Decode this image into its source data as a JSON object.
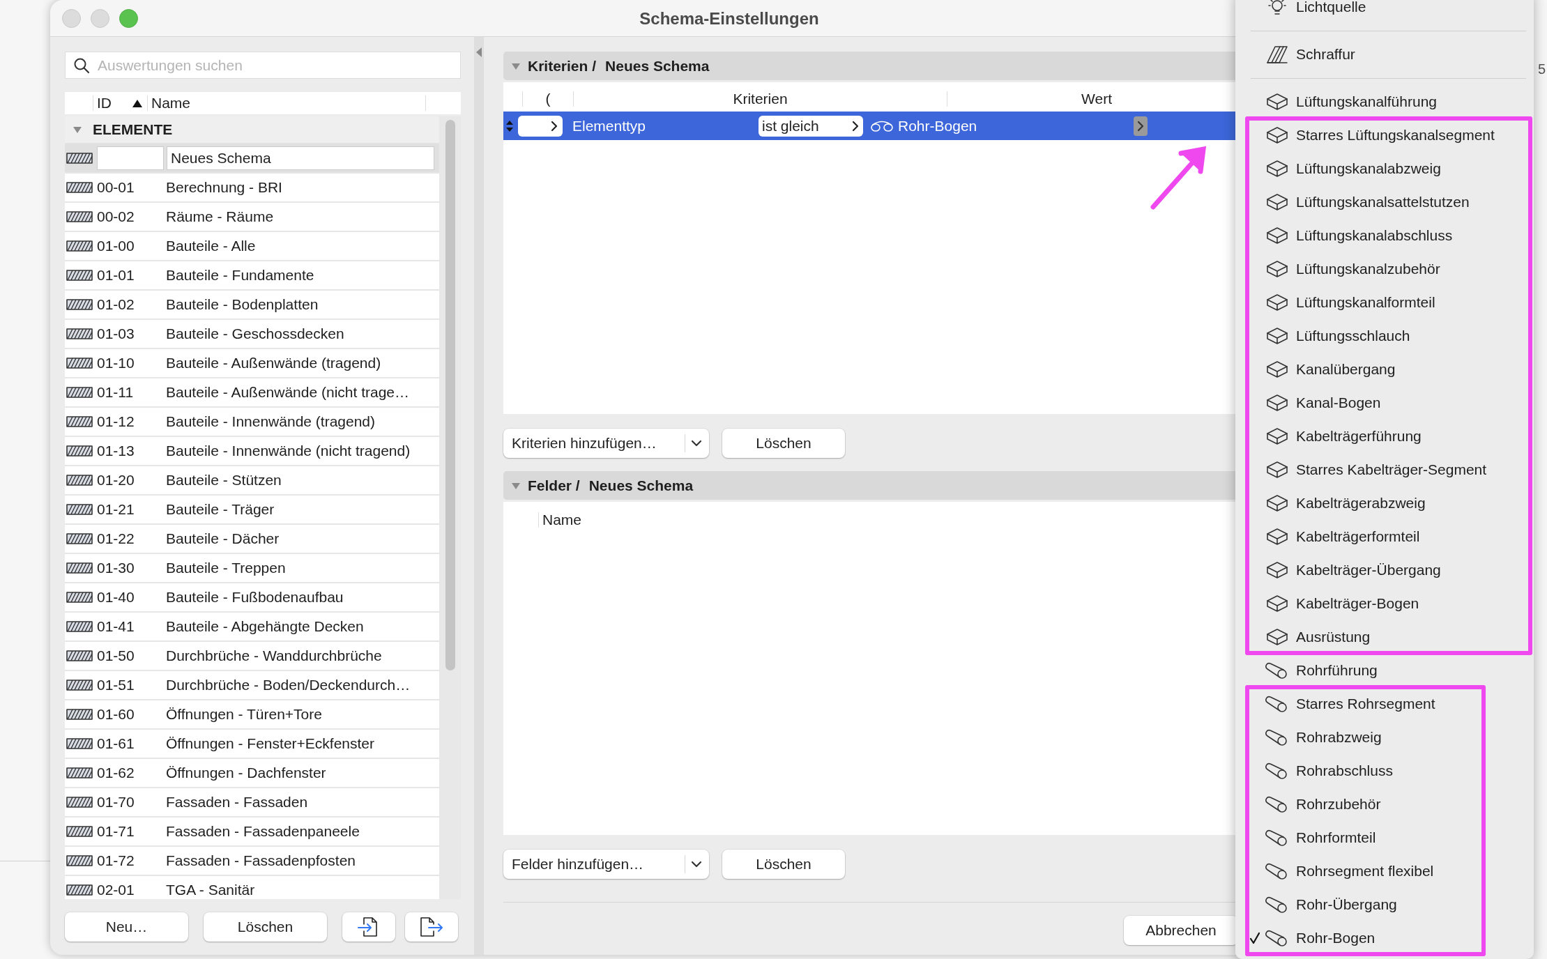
{
  "window": {
    "title": "Schema-Einstellungen"
  },
  "sidebar": {
    "search": {
      "placeholder": "Auswertungen suchen"
    },
    "columns": [
      {
        "label": "ID",
        "sorted": true
      },
      {
        "label": "Name",
        "sorted": false
      }
    ],
    "group": {
      "label": "ELEMENTE",
      "expanded": true
    },
    "rows": [
      {
        "name": "Neues Schema",
        "editing": true
      },
      {
        "id": "00-01",
        "name": "Berechnung - BRI",
        "editing": false
      },
      {
        "id": "00-02",
        "name": "Räume - Räume",
        "editing": false
      },
      {
        "id": "01-00",
        "name": "Bauteile - Alle",
        "editing": false
      },
      {
        "id": "01-01",
        "name": "Bauteile - Fundamente",
        "editing": false
      },
      {
        "id": "01-02",
        "name": "Bauteile - Bodenplatten",
        "editing": false
      },
      {
        "id": "01-03",
        "name": "Bauteile - Geschossdecken",
        "editing": false
      },
      {
        "id": "01-10",
        "name": "Bauteile - Außenwände (tragend)",
        "editing": false
      },
      {
        "id": "01-11",
        "name": "Bauteile - Außenwände (nicht trage…",
        "editing": false
      },
      {
        "id": "01-12",
        "name": "Bauteile - Innenwände (tragend)",
        "editing": false
      },
      {
        "id": "01-13",
        "name": "Bauteile - Innenwände (nicht tragend)",
        "editing": false
      },
      {
        "id": "01-20",
        "name": "Bauteile - Stützen",
        "editing": false
      },
      {
        "id": "01-21",
        "name": "Bauteile - Träger",
        "editing": false
      },
      {
        "id": "01-22",
        "name": "Bauteile - Dächer",
        "editing": false
      },
      {
        "id": "01-30",
        "name": "Bauteile - Treppen",
        "editing": false
      },
      {
        "id": "01-40",
        "name": "Bauteile - Fußbodenaufbau",
        "editing": false
      },
      {
        "id": "01-41",
        "name": "Bauteile - Abgehängte Decken",
        "editing": false
      },
      {
        "id": "01-50",
        "name": "Durchbrüche - Wanddurchbrüche",
        "editing": false
      },
      {
        "id": "01-51",
        "name": "Durchbrüche - Boden/Deckendurch…",
        "editing": false
      },
      {
        "id": "01-60",
        "name": "Öffnungen - Türen+Tore",
        "editing": false
      },
      {
        "id": "01-61",
        "name": "Öffnungen - Fenster+Eckfenster",
        "editing": false
      },
      {
        "id": "01-62",
        "name": "Öffnungen - Dachfenster",
        "editing": false
      },
      {
        "id": "01-70",
        "name": "Fassaden - Fassaden",
        "editing": false
      },
      {
        "id": "01-71",
        "name": "Fassaden - Fassadenpaneele",
        "editing": false
      },
      {
        "id": "01-72",
        "name": "Fassaden - Fassadenpfosten",
        "editing": false
      },
      {
        "id": "02-01",
        "name": "TGA - Sanitär",
        "editing": false
      }
    ],
    "buttons": [
      {
        "kind": "text",
        "label": "Neu…"
      },
      {
        "kind": "text",
        "label": "Löschen"
      },
      {
        "kind": "import"
      },
      {
        "kind": "export"
      }
    ]
  },
  "criteria": {
    "title": "Kriterien /",
    "schema": "Neues Schema",
    "expanded": true,
    "columns": [
      "(",
      "Kriterien",
      "Wert"
    ],
    "rows": [
      {
        "selected": true,
        "field": "Elementtyp",
        "operator": "ist gleich",
        "value": "Rohr-Bogen"
      }
    ],
    "buttons": [
      {
        "kind": "dropdown",
        "label": "Kriterien hinzufügen…"
      },
      {
        "kind": "text",
        "label": "Löschen"
      }
    ]
  },
  "fields": {
    "title": "Felder /",
    "schema": "Neues Schema",
    "expanded": true,
    "columns": [
      "Name"
    ],
    "buttons": [
      {
        "kind": "dropdown",
        "label": "Felder hinzufügen…"
      },
      {
        "kind": "text",
        "label": "Löschen"
      }
    ]
  },
  "footer": {
    "buttons": [
      "Abbrechen"
    ]
  },
  "menu": {
    "groups": [
      {
        "framed": false,
        "items": [
          {
            "kind": "item",
            "label": "Lichtquelle",
            "checked": false
          },
          {
            "kind": "separator"
          },
          {
            "kind": "item",
            "label": "Schraffur",
            "checked": false
          },
          {
            "kind": "separator"
          },
          {
            "kind": "item",
            "label": "Lüftungskanalführung",
            "checked": false
          }
        ]
      },
      {
        "framed": true,
        "items": [
          {
            "kind": "item",
            "label": "Starres Lüftungskanalsegment",
            "checked": false
          },
          {
            "kind": "item",
            "label": "Lüftungskanalabzweig",
            "checked": false
          },
          {
            "kind": "item",
            "label": "Lüftungskanalsattelstutzen",
            "checked": false
          },
          {
            "kind": "item",
            "label": "Lüftungskanalabschluss",
            "checked": false
          },
          {
            "kind": "item",
            "label": "Lüftungskanalzubehör",
            "checked": false
          },
          {
            "kind": "item",
            "label": "Lüftungskanalformteil",
            "checked": false
          },
          {
            "kind": "item",
            "label": "Lüftungsschlauch",
            "checked": false
          },
          {
            "kind": "item",
            "label": "Kanalübergang",
            "checked": false
          },
          {
            "kind": "item",
            "label": "Kanal-Bogen",
            "checked": false
          },
          {
            "kind": "item",
            "label": "Kabelträgerführung",
            "checked": false
          },
          {
            "kind": "item",
            "label": "Starres Kabelträger-Segment",
            "checked": false
          },
          {
            "kind": "item",
            "label": "Kabelträgerabzweig",
            "checked": false
          },
          {
            "kind": "item",
            "label": "Kabelträgerformteil",
            "checked": false
          },
          {
            "kind": "item",
            "label": "Kabelträger-Übergang",
            "checked": false
          },
          {
            "kind": "item",
            "label": "Kabelträger-Bogen",
            "checked": false
          },
          {
            "kind": "item",
            "label": "Ausrüstung",
            "checked": false
          }
        ]
      },
      {
        "framed": false,
        "items": [
          {
            "kind": "item",
            "label": "Rohrführung",
            "checked": false
          }
        ]
      },
      {
        "framed": true,
        "items": [
          {
            "kind": "item",
            "label": "Starres Rohrsegment",
            "checked": false
          },
          {
            "kind": "item",
            "label": "Rohrabzweig",
            "checked": false
          },
          {
            "kind": "item",
            "label": "Rohrabschluss",
            "checked": false
          },
          {
            "kind": "item",
            "label": "Rohrzubehör",
            "checked": false
          },
          {
            "kind": "item",
            "label": "Rohrformteil",
            "checked": false
          },
          {
            "kind": "item",
            "label": "Rohrsegment flexibel",
            "checked": false
          },
          {
            "kind": "item",
            "label": "Rohr-Übergang",
            "checked": false
          },
          {
            "kind": "item",
            "label": "Rohr-Bogen",
            "checked": true
          }
        ]
      }
    ]
  },
  "annotations": {
    "arrow": true
  },
  "background": {
    "edge_text": "5"
  }
}
